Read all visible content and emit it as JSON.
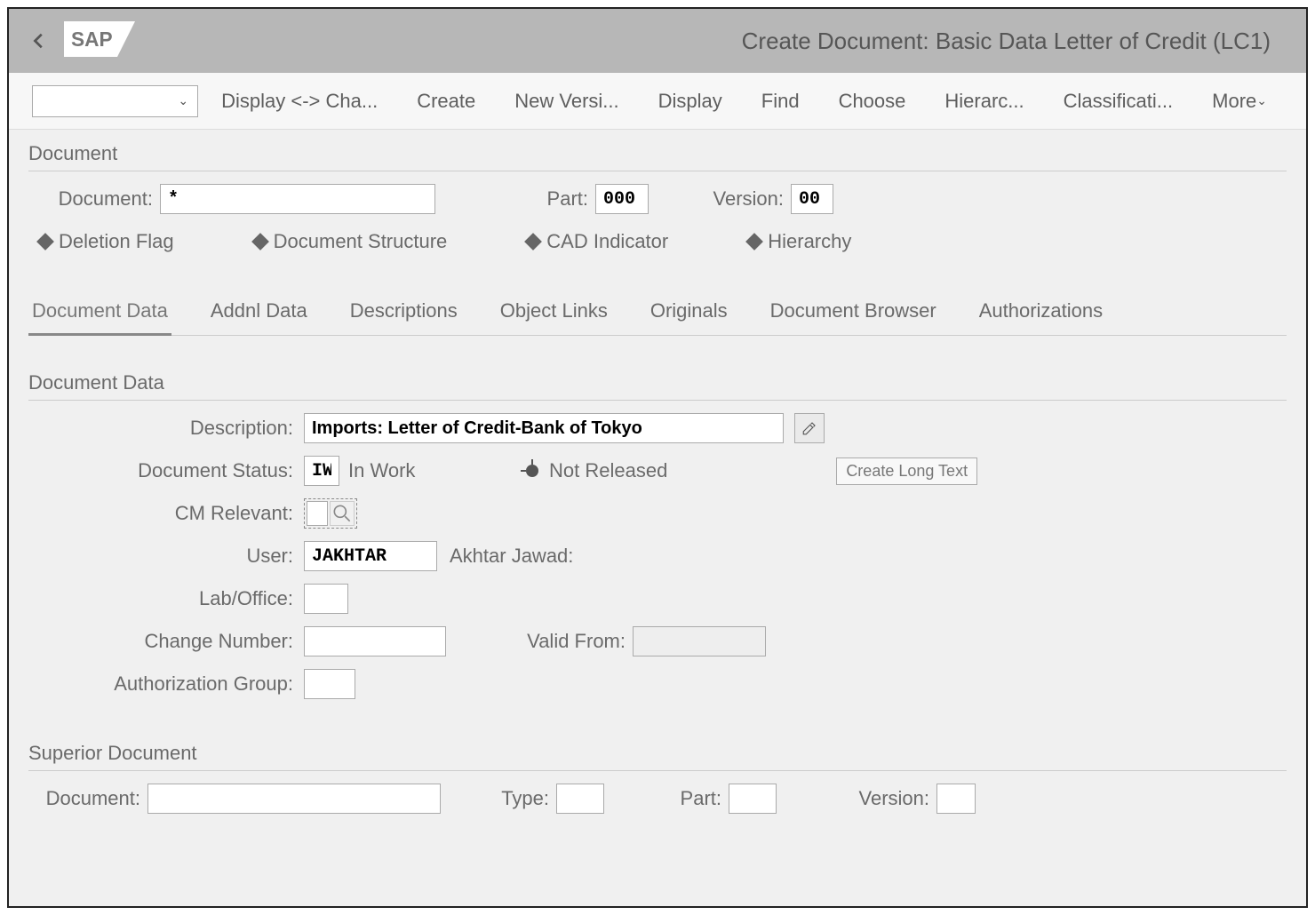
{
  "title": "Create Document: Basic Data Letter of Credit (LC1)",
  "toolbar": {
    "items": [
      "Display <-> Cha...",
      "Create",
      "New Versi...",
      "Display",
      "Find",
      "Choose",
      "Hierarc...",
      "Classificati..."
    ],
    "more": "More"
  },
  "doc_section": {
    "heading": "Document",
    "document_label": "Document:",
    "document_value": "*",
    "part_label": "Part:",
    "part_value": "000",
    "version_label": "Version:",
    "version_value": "00",
    "indicators": [
      "Deletion Flag",
      "Document Structure",
      "CAD Indicator",
      "Hierarchy"
    ]
  },
  "tabs": [
    "Document Data",
    "Addnl Data",
    "Descriptions",
    "Object Links",
    "Originals",
    "Document Browser",
    "Authorizations"
  ],
  "docdata": {
    "heading": "Document Data",
    "description_label": "Description:",
    "description_value": "Imports: Letter of Credit-Bank of Tokyo",
    "status_label": "Document Status:",
    "status_code": "IW",
    "status_text": "In Work",
    "not_released": "Not Released",
    "create_long_text": "Create Long Text",
    "cm_label": "CM Relevant:",
    "cm_value": "",
    "user_label": "User:",
    "user_value": "JAKHTAR",
    "user_name": "Akhtar Jawad:",
    "lab_label": "Lab/Office:",
    "change_label": "Change Number:",
    "valid_from_label": "Valid From:",
    "auth_label": "Authorization Group:"
  },
  "superior": {
    "heading": "Superior Document",
    "document_label": "Document:",
    "type_label": "Type:",
    "part_label": "Part:",
    "version_label": "Version:"
  }
}
